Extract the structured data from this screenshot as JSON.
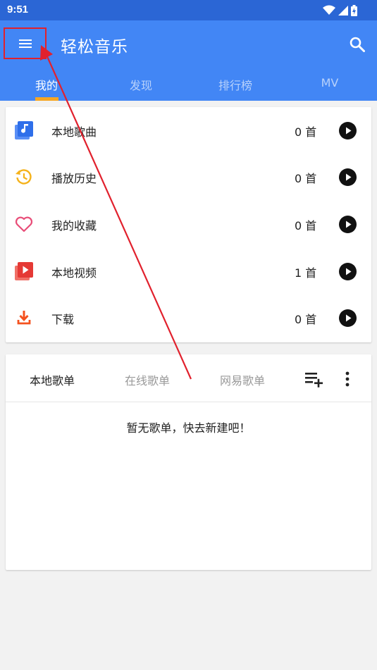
{
  "status_bar": {
    "time": "9:51",
    "icons": [
      "wifi-icon",
      "cell-signal-icon",
      "battery-charging-icon"
    ]
  },
  "app_bar": {
    "title": "轻松音乐",
    "menu_icon": "menu-icon",
    "search_icon": "search-icon"
  },
  "tabs": [
    {
      "label": "我的",
      "active": true
    },
    {
      "label": "发现",
      "active": false
    },
    {
      "label": "排行榜",
      "active": false
    },
    {
      "label": "MV",
      "active": false
    }
  ],
  "library": [
    {
      "icon": "local-music-icon",
      "label": "本地歌曲",
      "count": "0 首",
      "action_icon": "play-icon"
    },
    {
      "icon": "history-icon",
      "label": "播放历史",
      "count": "0 首",
      "action_icon": "play-icon"
    },
    {
      "icon": "heart-icon",
      "label": "我的收藏",
      "count": "0 首",
      "action_icon": "play-icon"
    },
    {
      "icon": "local-video-icon",
      "label": "本地视频",
      "count": "1 首",
      "action_icon": "play-icon"
    },
    {
      "icon": "download-icon",
      "label": "下载",
      "count": "0 首",
      "action_icon": "play-icon"
    }
  ],
  "playlists": {
    "tabs": [
      {
        "label": "本地歌单",
        "active": true
      },
      {
        "label": "在线歌单",
        "active": false
      },
      {
        "label": "网易歌单",
        "active": false
      }
    ],
    "add_icon": "playlist-add-icon",
    "more_icon": "more-vert-icon",
    "empty_text": "暂无歌单，快去新建吧！"
  },
  "colors": {
    "status_bar": "#2b66d5",
    "app_bar": "#4286f5",
    "tab_indicator": "#f6a623",
    "highlight": "#e1212d",
    "background": "#f2f2f2"
  }
}
